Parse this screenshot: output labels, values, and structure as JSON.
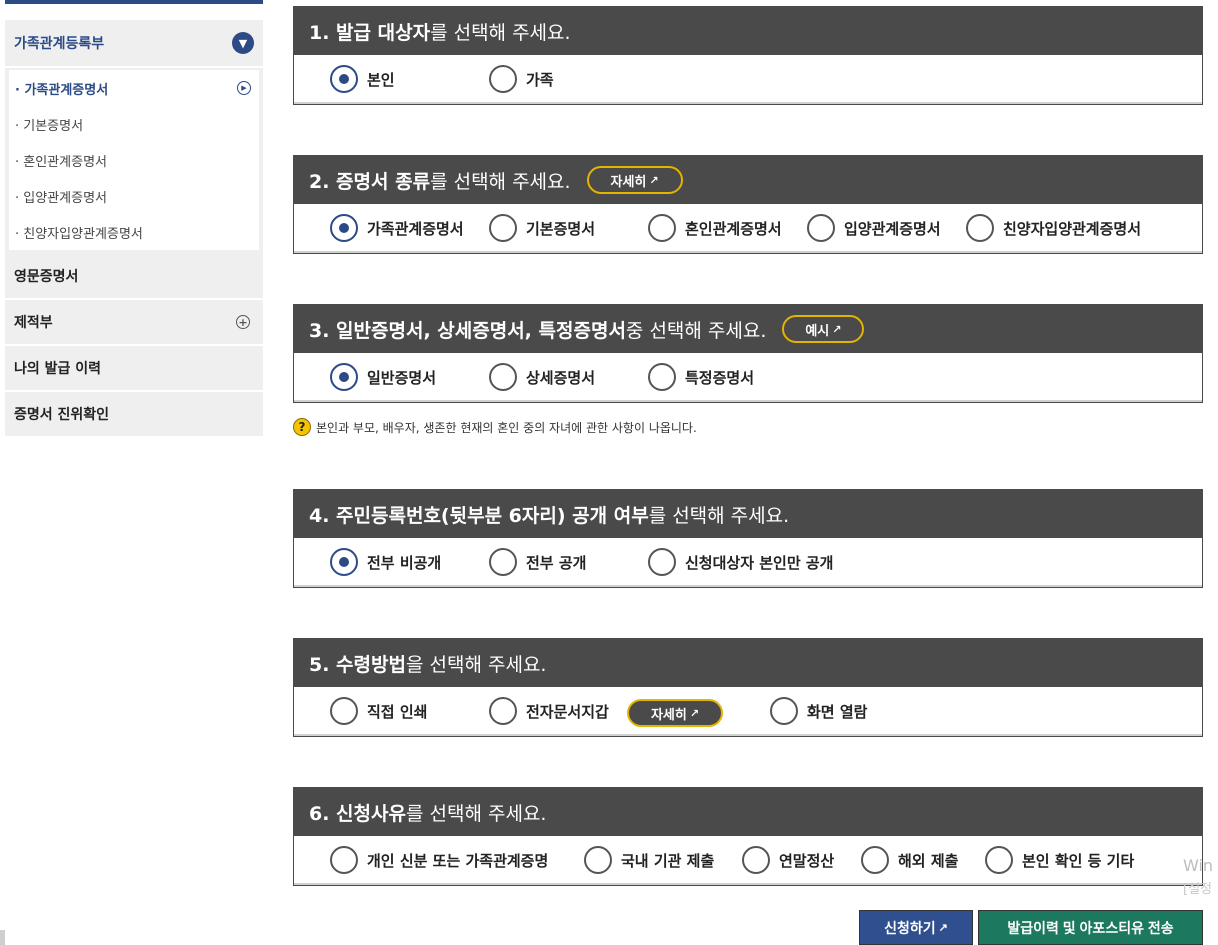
{
  "sidebar": {
    "section_family": "가족관계등록부",
    "sub_items": [
      "· 가족관계증명서",
      "· 기본증명서",
      "· 혼인관계증명서",
      "· 입양관계증명서",
      "· 친양자입양관계증명서"
    ],
    "section_english": "영문증명서",
    "section_removed": "제적부",
    "section_history": "나의 발급 이력",
    "section_verify": "증명서 진위확인"
  },
  "q1": {
    "title_bold": "1. 발급 대상자",
    "title_rest": "를 선택해 주세요.",
    "options": [
      "본인",
      "가족"
    ],
    "selected": "본인"
  },
  "q2": {
    "title_bold": "2. 증명서 종류",
    "title_rest": "를 선택해 주세요.",
    "pill": "자세히",
    "options": [
      "가족관계증명서",
      "기본증명서",
      "혼인관계증명서",
      "입양관계증명서",
      "친양자입양관계증명서"
    ],
    "selected": "가족관계증명서"
  },
  "q3": {
    "title_bold": "3. 일반증명서, 상세증명서, 특정증명서",
    "title_rest": " 중 선택해 주세요.",
    "pill": "예시",
    "options": [
      "일반증명서",
      "상세증명서",
      "특정증명서"
    ],
    "selected": "일반증명서",
    "hint": "본인과 부모, 배우자, 생존한 현재의 혼인 중의 자녀에 관한 사항이 나옵니다."
  },
  "q4": {
    "title_bold": "4. 주민등록번호(뒷부분 6자리) 공개 여부",
    "title_rest": "를 선택해 주세요.",
    "options": [
      "전부 비공개",
      "전부 공개",
      "신청대상자 본인만 공개"
    ],
    "selected": "전부 비공개"
  },
  "q5": {
    "title_bold": "5. 수령방법",
    "title_rest": "을 선택해 주세요.",
    "options": [
      "직접 인쇄",
      "전자문서지갑",
      "화면 열람"
    ],
    "pill": "자세히",
    "selected": ""
  },
  "q6": {
    "title_bold": "6. 신청사유",
    "title_rest": "를 선택해 주세요.",
    "options": [
      "개인 신분 또는 가족관계증명",
      "국내 기관 제출",
      "연말정산",
      "해외 제출",
      "본인 확인 등 기타"
    ],
    "selected": ""
  },
  "buttons": {
    "apply": "신청하기",
    "send": "발급이력 및 아포스티유 전송"
  },
  "icons": {
    "ext": "↗",
    "hint": "?",
    "plus": "+",
    "chevron": "⌄",
    "play": "▶"
  },
  "watermark": [
    "Win",
    "[설정"
  ],
  "colors": {
    "header": "#4a4a4a",
    "accent": "#2b4a86",
    "pill_border": "#e3b400",
    "apply": "#2f4f8e",
    "send": "#1d7860"
  }
}
